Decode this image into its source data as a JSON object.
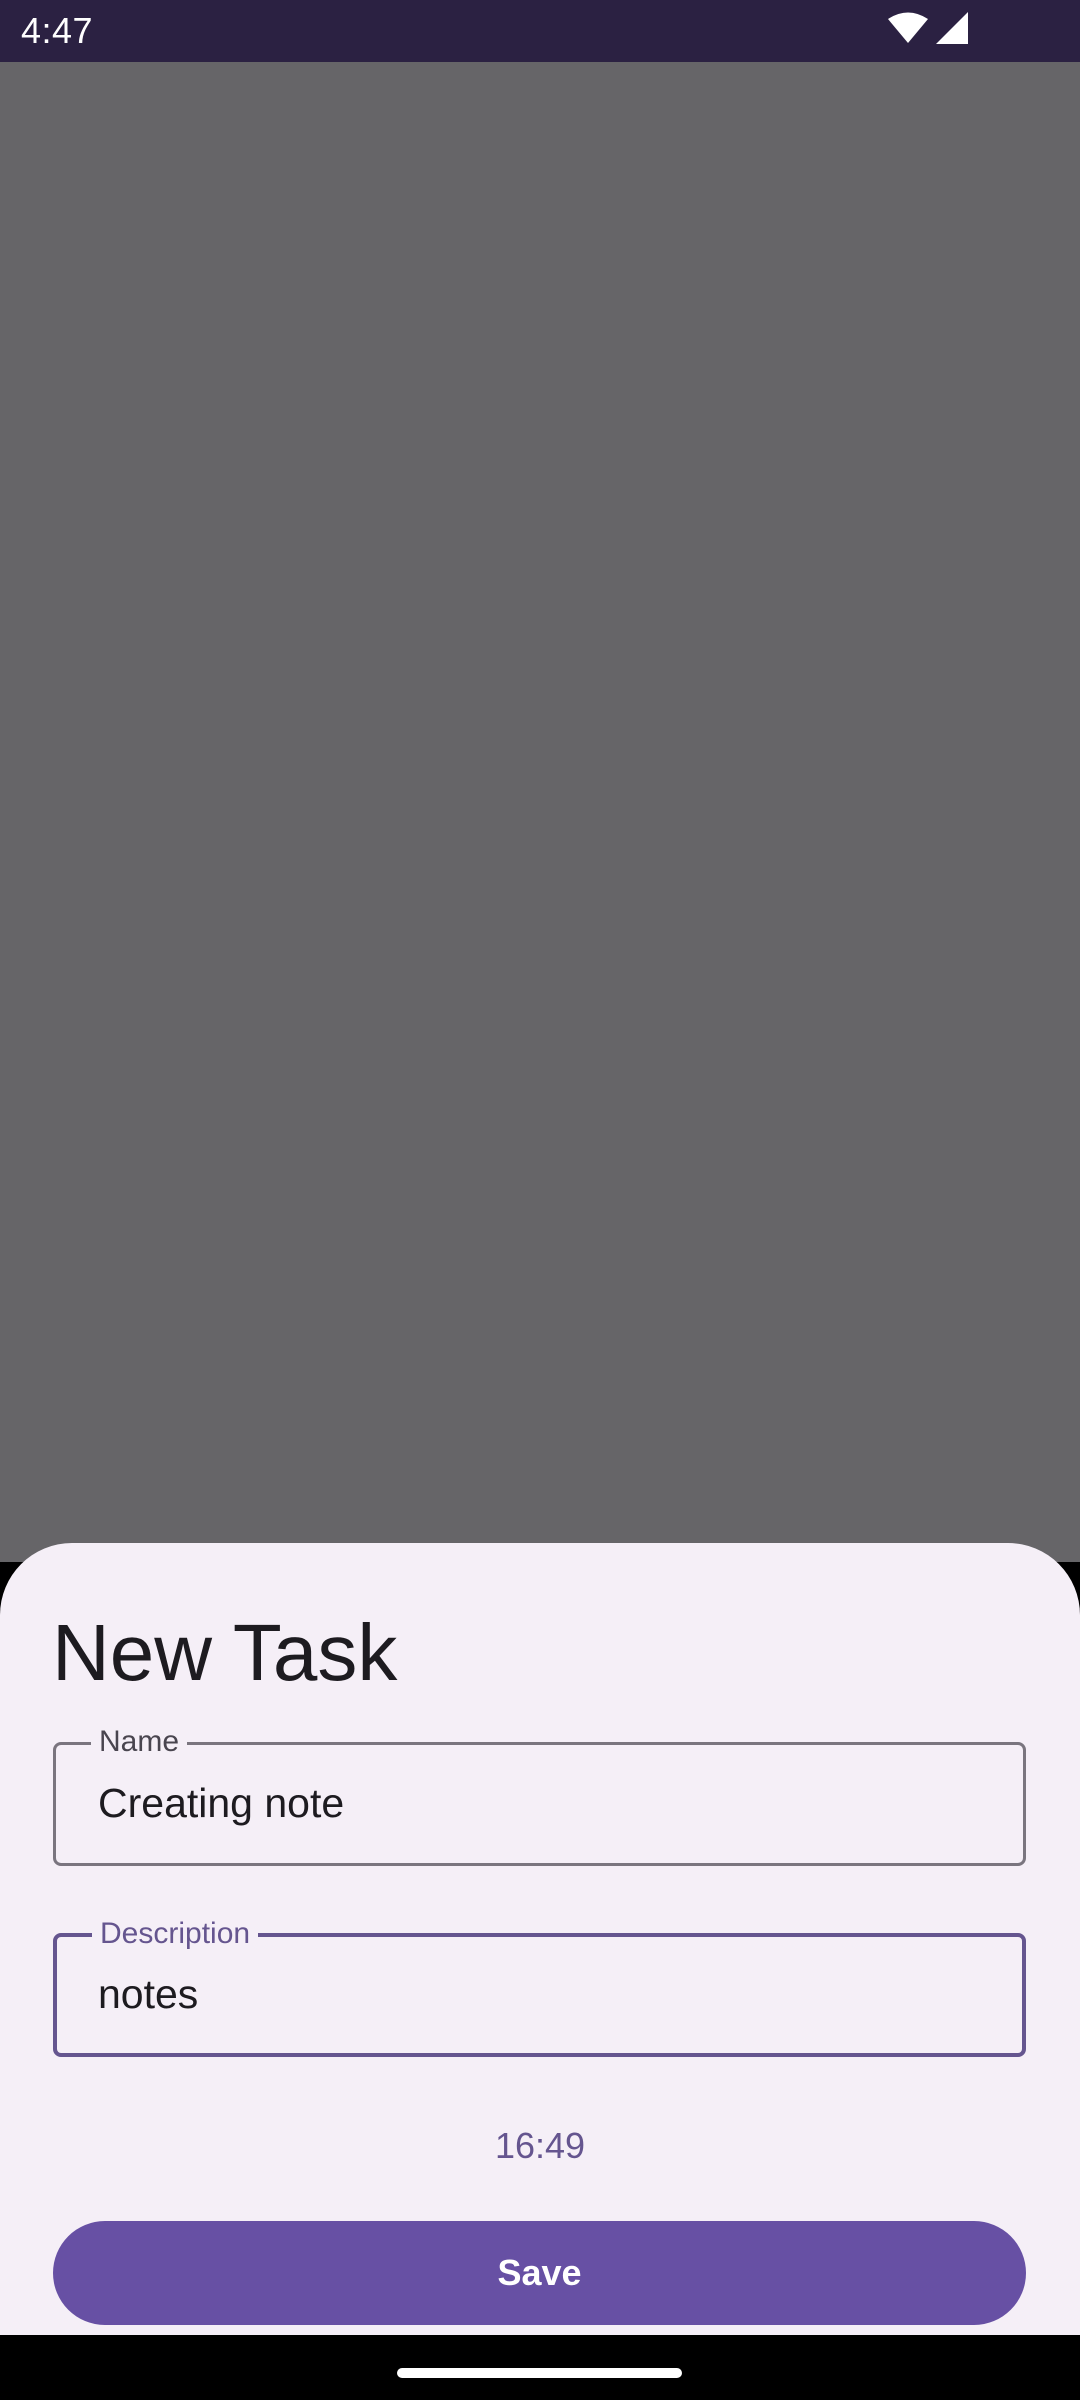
{
  "status_bar": {
    "time": "4:47",
    "icons": [
      "wifi-icon",
      "cellular-signal-icon"
    ]
  },
  "sheet": {
    "title": "New Task",
    "name_field": {
      "label": "Name",
      "value": "Creating note"
    },
    "description_field": {
      "label": "Description",
      "value": "notes"
    },
    "time": "16:49",
    "save_label": "Save"
  },
  "colors": {
    "status_bar_bg": "#2b2142",
    "scrim": "#666568",
    "sheet_bg": "#f5eff7",
    "accent": "#6750a4",
    "focused_outline": "#65558f",
    "text_primary": "#1d1b20"
  }
}
